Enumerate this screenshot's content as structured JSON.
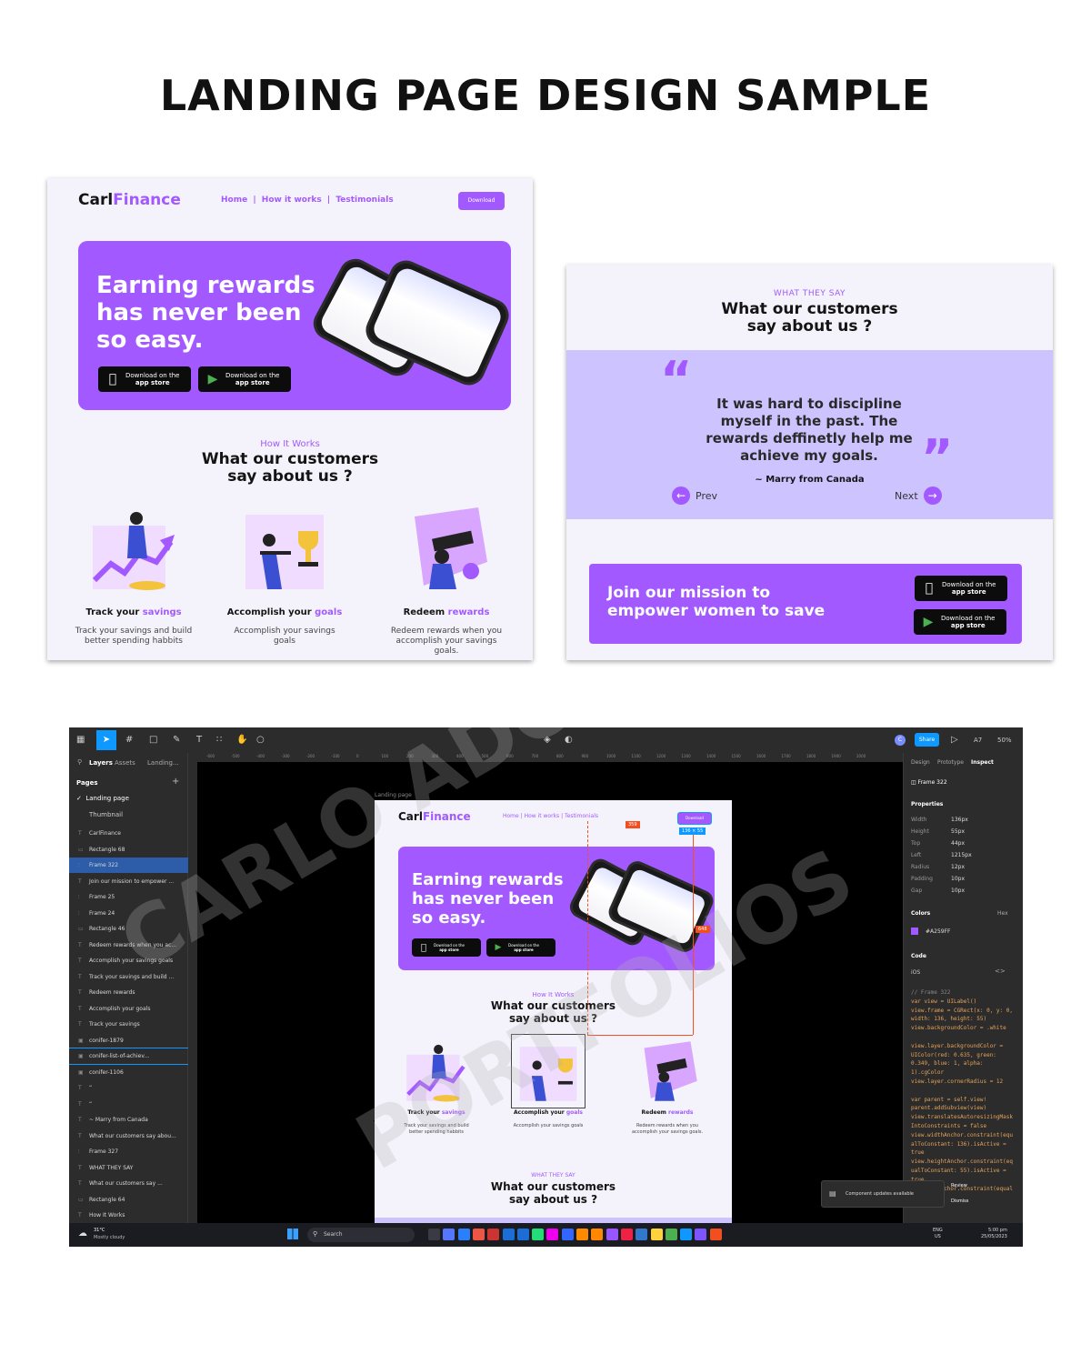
{
  "page_title": "LANDING PAGE DESIGN SAMPLE",
  "brand": {
    "name_dark": "Carl",
    "name_accent": "Finance",
    "accent": "#a259ff"
  },
  "nav": {
    "home": "Home",
    "sep": "|",
    "how": "How it works",
    "testimonials": "Testimonials",
    "download": "Download"
  },
  "hero": {
    "line1": "Earning rewards",
    "line2": "has never been",
    "line3": "so easy."
  },
  "store": {
    "apple_small": "Download on the",
    "apple_big": "app store",
    "google_small": "Download on the",
    "google_big": "app store"
  },
  "how": {
    "eyebrow": "How It Works",
    "title_line1": "What our customers",
    "title_line2": "say about us ?"
  },
  "features": [
    {
      "head": "Track your ",
      "accent": "savings",
      "desc": "Track your savings and build better spending habbits"
    },
    {
      "head": "Accomplish your ",
      "accent": "goals",
      "desc": "Accomplish your savings goals"
    },
    {
      "head": "Redeem ",
      "accent": "rewards",
      "desc": "Redeem rewards when you accomplish your savings goals."
    }
  ],
  "testimonial": {
    "eyebrow": "WHAT THEY SAY",
    "title_line1": "What our customers",
    "title_line2": "say about us ?",
    "quote": "It was hard to discipline myself in the past. The rewards deffinetly help me achieve my goals.",
    "author": "~ Marry from Canada",
    "prev": "Prev",
    "next": "Next"
  },
  "mission": {
    "line1": "Join our mission to",
    "line2": "empower women to save"
  },
  "figma": {
    "tabs": {
      "layers": "Layers",
      "assets": "Assets",
      "page": "Landing..."
    },
    "pages_label": "Pages",
    "pages": [
      "Landing page",
      "Thumbnail"
    ],
    "layers": [
      "CarlFinance",
      "Rectangle 68",
      "Frame 322",
      "Join our mission to empower ...",
      "Frame 25",
      "Frame 24",
      "Rectangle 46",
      "Redeem rewards when you ac...",
      "Accomplish your savings goals",
      "Track your savings and build ...",
      "Redeem rewards",
      "Accomplish your goals",
      "Track your savings",
      "conifer-1879",
      "conifer-list-of-achiev...",
      "conifer-1106",
      "“",
      "“",
      "~ Marry from Canada",
      "What our customers say abou...",
      "Frame 327",
      "WHAT THEY SAY",
      "What our customers say ...",
      "Rectangle 64",
      "How It Works"
    ],
    "ruler": [
      "-600",
      "-500",
      "-400",
      "-300",
      "-200",
      "-100",
      "0",
      "100",
      "200",
      "300",
      "400",
      "500",
      "600",
      "700",
      "800",
      "900",
      "1000",
      "1100",
      "1200",
      "1300",
      "1400",
      "1500",
      "1600",
      "1700",
      "1800",
      "1900",
      "2000"
    ],
    "frame_label": "Landing page",
    "badge_top": "359",
    "badge_size": "136 × 55",
    "badge_side": "648",
    "right_tabs": {
      "design": "Design",
      "prototype": "Prototype",
      "inspect": "Inspect"
    },
    "frame_name": "Frame 322",
    "properties_label": "Properties",
    "props": [
      {
        "k": "Width",
        "v": "136px"
      },
      {
        "k": "Height",
        "v": "55px"
      },
      {
        "k": "Top",
        "v": "44px"
      },
      {
        "k": "Left",
        "v": "1215px"
      },
      {
        "k": "Radius",
        "v": "12px"
      },
      {
        "k": "Padding",
        "v": "10px"
      },
      {
        "k": "Gap",
        "v": "10px"
      }
    ],
    "colors_label": "Colors",
    "colors_mode": "Hex",
    "color_hex": "#A259FF",
    "code_label": "Code",
    "code_lang": "iOS",
    "code": [
      "// Frame 322",
      "var view = UILabel()",
      "view.frame = CGRect(x: 0, y: 0,",
      "width: 136, height: 55)",
      "view.backgroundColor = .white",
      "",
      "view.layer.backgroundColor =",
      "UIColor(red: 0.635, green:",
      "0.349, blue: 1, alpha:",
      "1).cgColor",
      "view.layer.cornerRadius = 12",
      "",
      "var parent = self.view!",
      "parent.addSubview(view)",
      "view.translatesAutoresizingMask",
      "IntoConstraints = false",
      "view.widthAnchor.constraint(equ",
      "alToConstant: 136).isActive =",
      "true",
      "view.heightAnchor.constraint(eq",
      "ualToConstant: 55).isActive =",
      "true",
      "view.topAnchor.constraint(equal"
    ],
    "share": "Share",
    "zoom": "50%",
    "avatar": "C",
    "user_short": "A7",
    "toast": "Component updates available",
    "review": "Review",
    "dismiss": "Dismiss",
    "weather_temp": "31°C",
    "weather_desc": "Mostly cloudy",
    "search": "Search",
    "lang1": "ENG",
    "lang2": "US",
    "time": "5:00 pm",
    "date": "25/05/2023"
  },
  "watermark": {
    "line1": "CARLO ADORABLE",
    "line2": "PORTFOLIOS"
  }
}
